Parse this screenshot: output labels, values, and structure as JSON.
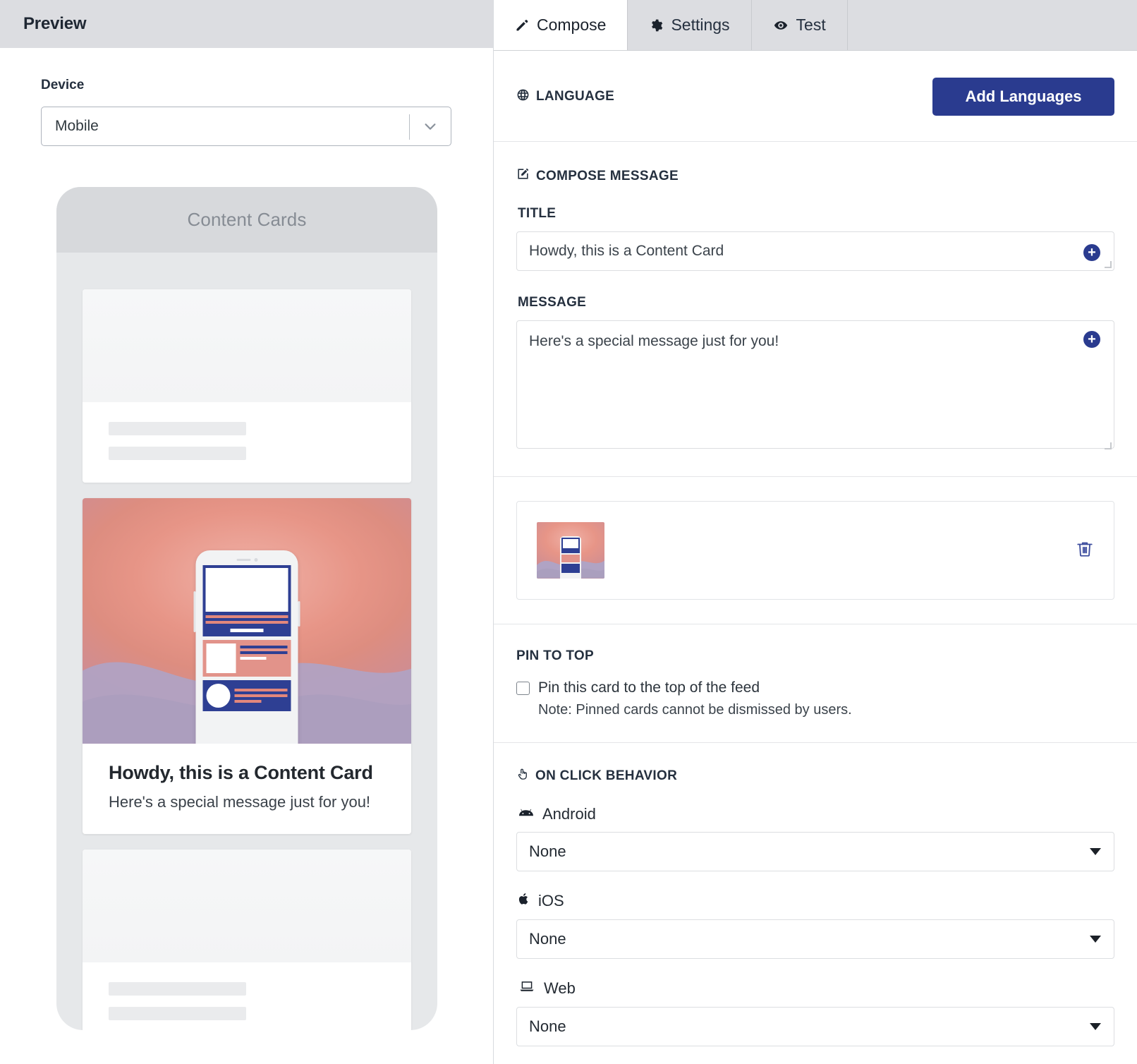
{
  "preview": {
    "header_title": "Preview",
    "device_label": "Device",
    "device_value": "Mobile",
    "device_options": [
      "Mobile"
    ],
    "phone_bar_title": "Content Cards",
    "card": {
      "title": "Howdy, this is a Content Card",
      "message": "Here's a special message just for you!"
    }
  },
  "tabs": [
    {
      "label": "Compose",
      "icon": "pencil-icon",
      "active": true
    },
    {
      "label": "Settings",
      "icon": "gear-icon",
      "active": false
    },
    {
      "label": "Test",
      "icon": "eye-icon",
      "active": false
    }
  ],
  "language": {
    "heading": "LANGUAGE",
    "icon": "globe-icon",
    "add_button": "Add Languages"
  },
  "compose": {
    "heading": "COMPOSE MESSAGE",
    "icon": "compose-icon",
    "title_label": "TITLE",
    "title_value": "Howdy, this is a Content Card",
    "title_placeholder": "Howdy, this is a Content Card",
    "message_label": "MESSAGE",
    "message_value": "Here's a special message just for you!",
    "message_placeholder": "Here's a special message just for you!",
    "add_attribute_icon": "plus-circle-icon"
  },
  "media": {
    "thumbnail_name": "content-card-image-thumbnail",
    "delete_icon": "trash-icon"
  },
  "pin": {
    "heading": "PIN TO TOP",
    "checkbox_label": "Pin this card to the top of the feed",
    "checked": false,
    "note": "Note: Pinned cards cannot be dismissed by users."
  },
  "on_click": {
    "heading": "ON CLICK BEHAVIOR",
    "icon": "pointer-hand-icon",
    "platforms": [
      {
        "name": "Android",
        "icon": "android-icon",
        "value": "None"
      },
      {
        "name": "iOS",
        "icon": "apple-icon",
        "value": "None"
      },
      {
        "name": "Web",
        "icon": "laptop-icon",
        "value": "None"
      }
    ]
  },
  "colors": {
    "brand_blue": "#2a3b8f",
    "accent_coral": "#e2938a",
    "header_gray": "#dcdde1",
    "text_dark": "#25303f"
  }
}
